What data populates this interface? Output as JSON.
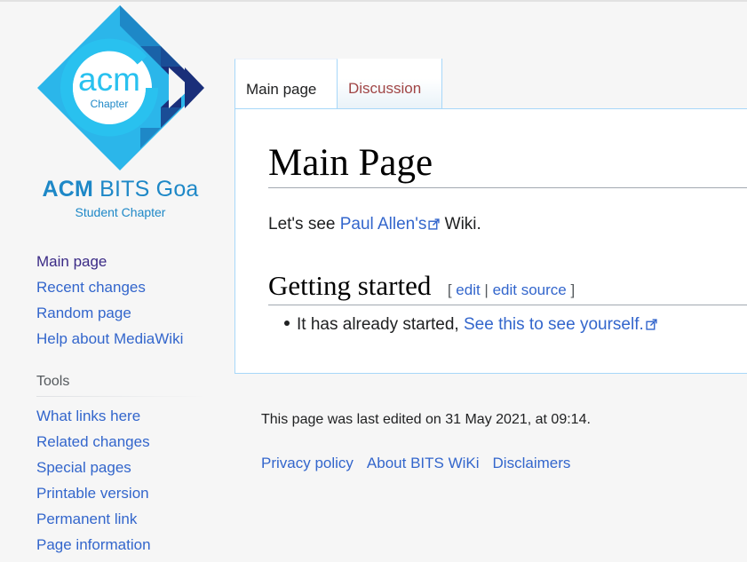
{
  "logo": {
    "acm_text": "acm",
    "chapter_text": "Chapter",
    "title_bold": "ACM",
    "title_rest": " BITS Goa",
    "subtitle": "Student Chapter",
    "colors": {
      "light": "#29c1ef",
      "mid": "#1e88c7",
      "dark": "#1a2f7a"
    }
  },
  "sidebar": {
    "navigation": [
      {
        "label": "Main page"
      },
      {
        "label": "Recent changes"
      },
      {
        "label": "Random page"
      },
      {
        "label": "Help about MediaWiki"
      }
    ],
    "tools_heading": "Tools",
    "tools": [
      {
        "label": "What links here"
      },
      {
        "label": "Related changes"
      },
      {
        "label": "Special pages"
      },
      {
        "label": "Printable version"
      },
      {
        "label": "Permanent link"
      },
      {
        "label": "Page information"
      }
    ]
  },
  "tabs": [
    {
      "label": "Main page",
      "selected": true
    },
    {
      "label": "Discussion",
      "selected": false
    }
  ],
  "content": {
    "title": "Main Page",
    "intro_before": "Let's see ",
    "intro_link": "Paul Allen's",
    "intro_after": " Wiki.",
    "section_title": "Getting started",
    "edit_open": "[ ",
    "edit_link": "edit",
    "edit_sep": " | ",
    "edit_source_link": "edit source",
    "edit_close": " ]",
    "bullet_text": "It has already started, ",
    "bullet_link": "See this to see yourself."
  },
  "footer": {
    "last_modified": "This page was last edited on 31 May 2021, at 09:14.",
    "links": [
      {
        "label": "Privacy policy"
      },
      {
        "label": "About BITS WiKi"
      },
      {
        "label": "Disclaimers"
      }
    ]
  },
  "colors": {
    "link": "#3366cc",
    "visited_link": "#3b2b86",
    "new_link": "#a04545",
    "border": "#a7d7f9"
  }
}
